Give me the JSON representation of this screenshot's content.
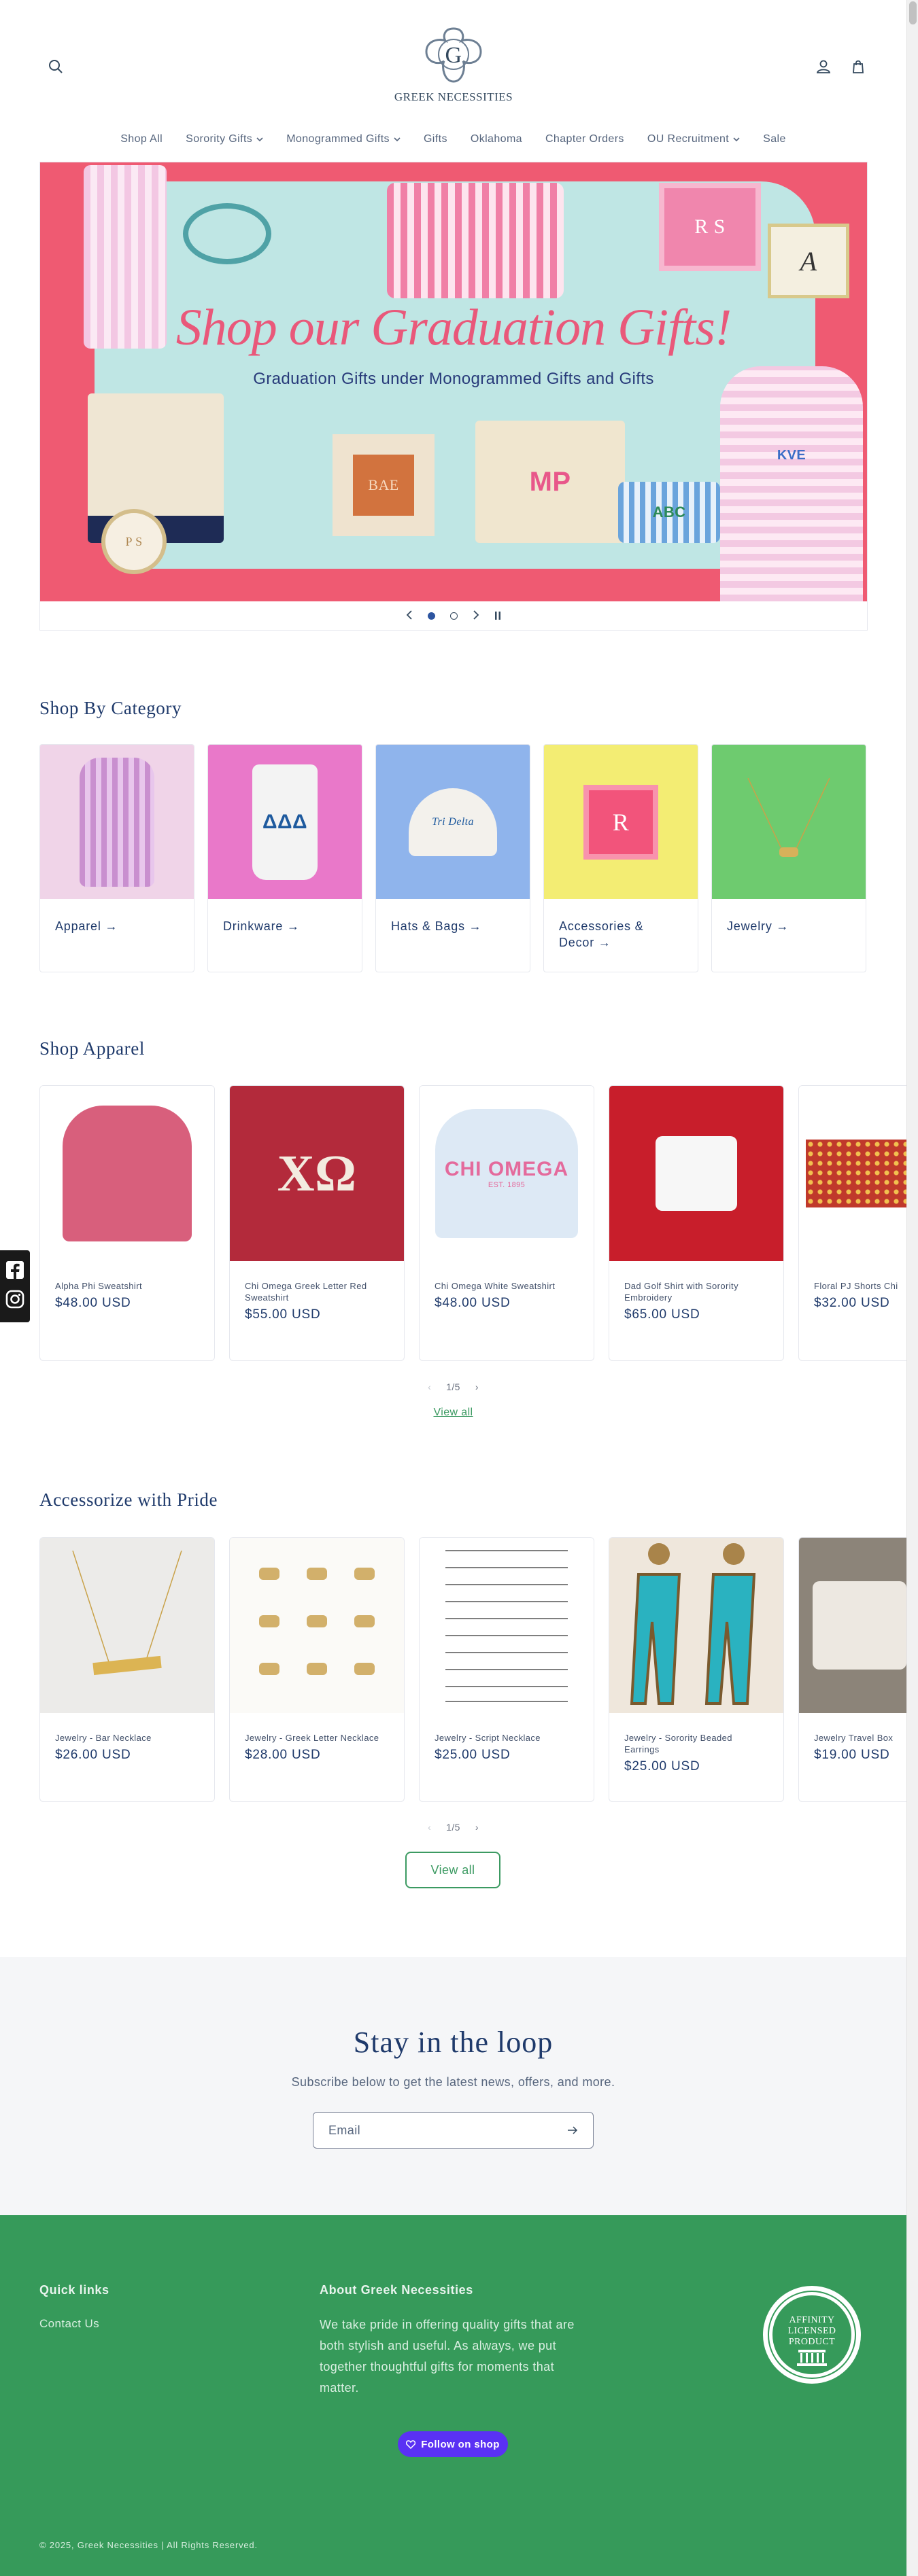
{
  "store": {
    "name": "GREEK NECESSITIES"
  },
  "nav": {
    "items": [
      {
        "label": "Shop All",
        "dropdown": false
      },
      {
        "label": "Sorority Gifts",
        "dropdown": true
      },
      {
        "label": "Monogrammed Gifts",
        "dropdown": true
      },
      {
        "label": "Gifts",
        "dropdown": false
      },
      {
        "label": "Oklahoma",
        "dropdown": false
      },
      {
        "label": "Chapter Orders",
        "dropdown": false
      },
      {
        "label": "OU Recruitment",
        "dropdown": true
      },
      {
        "label": "Sale",
        "dropdown": false
      }
    ]
  },
  "hero": {
    "title": "Shop our Graduation Gifts!",
    "subtitle": "Graduation Gifts under Monogrammed Gifts and Gifts",
    "monogram_labels": [
      "R S",
      "A",
      "BAE",
      "MP",
      "ABC",
      "P S",
      "KVE"
    ],
    "slide_count": 2,
    "active_slide": 1,
    "prev_icon": "chevron-left-icon",
    "next_icon": "chevron-right-icon",
    "pause_icon": "pause-icon"
  },
  "categories": {
    "heading": "Shop By Category",
    "items": [
      {
        "label": "Apparel →",
        "color": "#f0d4e8"
      },
      {
        "label": "Drinkware →",
        "color": "#e978c9"
      },
      {
        "label": "Hats & Bags →",
        "color": "#8fb4ec"
      },
      {
        "label": "Accessories & Decor →",
        "color": "#f3ed73"
      },
      {
        "label": "Jewelry →",
        "color": "#6ecb6f"
      }
    ],
    "image_text": {
      "drinkware": "ΔΔΔ",
      "hat": "Tri Delta",
      "accessory": "R"
    }
  },
  "apparel": {
    "heading": "Shop Apparel",
    "products": [
      {
        "name": "Alpha Phi Sweatshirt",
        "price": "$48.00 USD"
      },
      {
        "name": "Chi Omega Greek Letter Red Sweatshirt",
        "price": "$55.00 USD",
        "image_text": "XΩ"
      },
      {
        "name": "Chi Omega White Sweatshirt",
        "price": "$48.00 USD",
        "image_text": "CHI OMEGA",
        "image_subtext": "EST. 1895"
      },
      {
        "name": "Dad Golf Shirt with Sorority Embroidery",
        "price": "$65.00 USD"
      },
      {
        "name": "Floral PJ Shorts Chi",
        "price": "$32.00 USD"
      }
    ],
    "pager": "1/5",
    "view_all": "View all"
  },
  "accessories": {
    "heading": "Accessorize with Pride",
    "products": [
      {
        "name": "Jewelry - Bar Necklace",
        "price": "$26.00 USD"
      },
      {
        "name": "Jewelry - Greek Letter Necklace",
        "price": "$28.00 USD"
      },
      {
        "name": "Jewelry - Script Necklace",
        "price": "$25.00 USD"
      },
      {
        "name": "Jewelry - Sorority Beaded Earrings",
        "price": "$25.00 USD"
      },
      {
        "name": "Jewelry Travel Box",
        "price": "$19.00 USD"
      }
    ],
    "pager": "1/5",
    "view_all": "View all"
  },
  "newsletter": {
    "heading": "Stay in the loop",
    "subtext": "Subscribe below to get the latest news, offers, and more.",
    "email_placeholder": "Email"
  },
  "footer": {
    "quick_links_heading": "Quick links",
    "links": [
      "Contact Us"
    ],
    "about_heading": "About Greek Necessities",
    "about_text": "We take pride in offering quality gifts that are both stylish and useful. As always, we put together thoughtful gifts for moments that matter.",
    "shop_button": "Follow on shop",
    "badge_text": [
      "AFFINITY",
      "LICENSED",
      "PRODUCT"
    ],
    "copyright": "© 2025, Greek Necessities | All Rights Reserved."
  },
  "colors": {
    "accent_green": "#369a5a",
    "navy": "#1f3a6b",
    "hero_pink": "#ef5a72",
    "shop_purple": "#5a31f4"
  }
}
